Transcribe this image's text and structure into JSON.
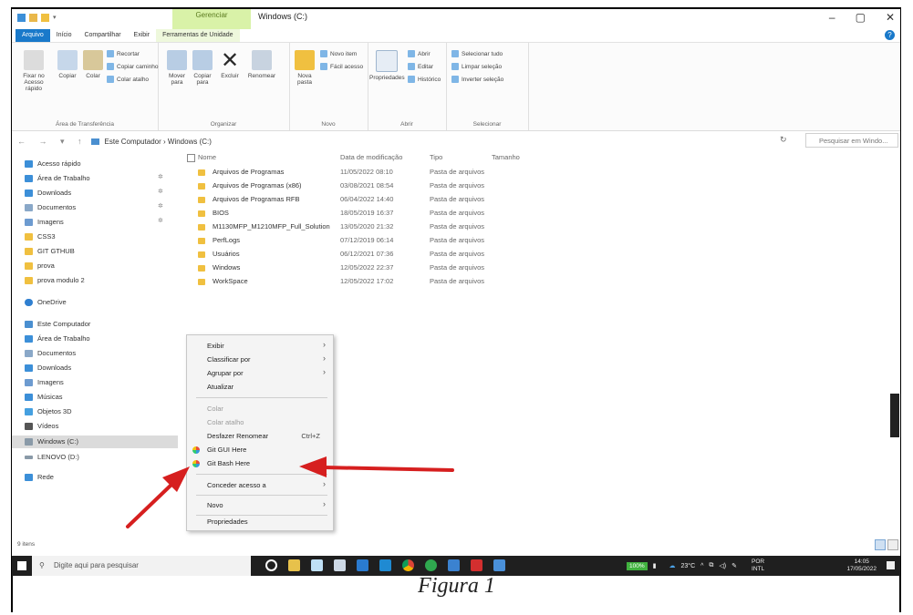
{
  "titlebar": {
    "context_label": "Gerenciar",
    "window_title": "Windows (C:)",
    "min": "–",
    "max": "▢",
    "close": "✕"
  },
  "tabs": [
    "Arquivo",
    "Início",
    "Compartilhar",
    "Exibir",
    "Ferramentas de Unidade"
  ],
  "ribbon": {
    "pin": "Fixar no\nAcesso rápido",
    "copy": "Copiar",
    "paste": "Colar",
    "cut": "Recortar",
    "copy_path": "Copiar caminho",
    "paste_shortcut": "Colar atalho",
    "group_clipboard": "Área de Transferência",
    "move_to": "Mover\npara",
    "copy_to": "Copiar\npara",
    "delete": "Excluir",
    "rename": "Renomear",
    "group_organize": "Organizar",
    "new_folder": "Nova\npasta",
    "new_item": "Novo item",
    "easy_access": "Fácil acesso",
    "group_new": "Novo",
    "properties": "Propriedades",
    "open": "Abrir",
    "edit": "Editar",
    "history": "Histórico",
    "group_open": "Abrir",
    "select_all": "Selecionar tudo",
    "clear_selection": "Limpar seleção",
    "invert_selection": "Inverter seleção",
    "group_select": "Selecionar"
  },
  "address": {
    "arrows": "← → ▾ ↑",
    "path": "Este Computador  ›  Windows (C:)",
    "refresh": "↻",
    "search_placeholder": "Pesquisar em Windo..."
  },
  "nav": {
    "quick_access": "Acesso rápido",
    "items": [
      "Área de Trabalho",
      "Downloads",
      "Documentos",
      "Imagens",
      "CSS3",
      "GIT GTHUB",
      "prova",
      "prova modulo 2"
    ],
    "onedrive": "OneDrive",
    "this_pc": "Este Computador",
    "pc_items": [
      "Área de Trabalho",
      "Documentos",
      "Downloads",
      "Imagens",
      "Músicas",
      "Objetos 3D",
      "Vídeos",
      "Windows (C:)",
      "LENOVO (D:)"
    ],
    "network": "Rede"
  },
  "columns": {
    "name": "Nome",
    "date": "Data de modificação",
    "type": "Tipo",
    "size": "Tamanho"
  },
  "files": [
    {
      "name": "Arquivos de Programas",
      "date": "11/05/2022 08:10",
      "type": "Pasta de arquivos"
    },
    {
      "name": "Arquivos de Programas (x86)",
      "date": "03/08/2021 08:54",
      "type": "Pasta de arquivos"
    },
    {
      "name": "Arquivos de Programas RFB",
      "date": "06/04/2022 14:40",
      "type": "Pasta de arquivos"
    },
    {
      "name": "BIOS",
      "date": "18/05/2019 16:37",
      "type": "Pasta de arquivos"
    },
    {
      "name": "M1130MFP_M1210MFP_Full_Solution",
      "date": "13/05/2020 21:32",
      "type": "Pasta de arquivos"
    },
    {
      "name": "PerfLogs",
      "date": "07/12/2019 06:14",
      "type": "Pasta de arquivos"
    },
    {
      "name": "Usuários",
      "date": "06/12/2021 07:36",
      "type": "Pasta de arquivos"
    },
    {
      "name": "Windows",
      "date": "12/05/2022 22:37",
      "type": "Pasta de arquivos"
    },
    {
      "name": "WorkSpace",
      "date": "12/05/2022 17:02",
      "type": "Pasta de arquivos"
    }
  ],
  "menu": {
    "view": "Exibir",
    "sort_by": "Classificar por",
    "group_by": "Agrupar por",
    "refresh": "Atualizar",
    "paste": "Colar",
    "paste_shortcut": "Colar atalho",
    "undo_rename": "Desfazer Renomear",
    "undo_shortcut": "Ctrl+Z",
    "git_gui": "Git GUI Here",
    "git_bash": "Git Bash Here",
    "give_access": "Conceder acesso a",
    "new": "Novo",
    "properties": "Propriedades"
  },
  "status": {
    "count": "9 itens"
  },
  "taskbar": {
    "search": "Digite aqui para pesquisar",
    "battery": "100%",
    "temp": "23°C",
    "lang": "POR\nINTL",
    "time": "14:05",
    "date": "17/05/2022"
  },
  "caption": "Figura 1",
  "colors": {
    "accent": "#1979ca",
    "arrow": "#d61f1f",
    "folder": "#f0c040",
    "taskbar": "#1f1f1f"
  }
}
